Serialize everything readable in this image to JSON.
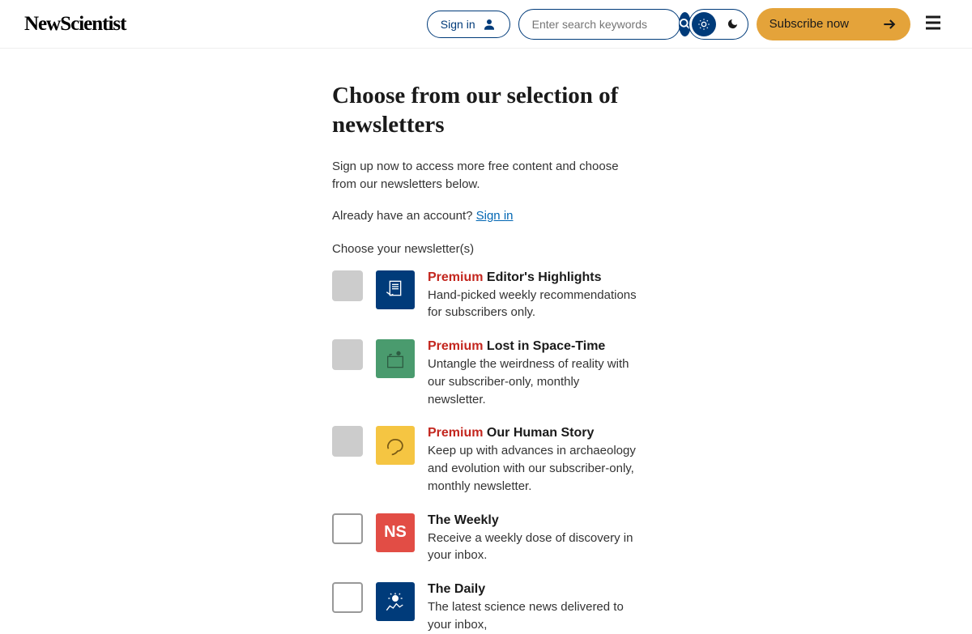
{
  "header": {
    "logo": "NewScientist",
    "signin": "Sign in",
    "search_placeholder": "Enter search keywords",
    "subscribe": "Subscribe now"
  },
  "page": {
    "title": "Choose from our selection of newsletters",
    "intro": "Sign up now to access more free content and choose from our newsletters below.",
    "account_prefix": "Already have an account? ",
    "signin_link": "Sign in",
    "choose_label": "Choose your newsletter(s)"
  },
  "newsletters": [
    {
      "premium": "Premium",
      "title": "Editor's Highlights",
      "desc": "Hand-picked weekly recommendations for subscribers only.",
      "disabled": true,
      "icon_bg": "#003b7a"
    },
    {
      "premium": "Premium",
      "title": "Lost in Space-Time",
      "desc": "Untangle the weirdness of reality with our subscriber-only, monthly newsletter.",
      "disabled": true,
      "icon_bg": "#4a9b6e"
    },
    {
      "premium": "Premium",
      "title": "Our Human Story",
      "desc": "Keep up with advances in archaeology and evolution with our subscriber-only, monthly newsletter.",
      "disabled": true,
      "icon_bg": "#f5c542"
    },
    {
      "premium": "",
      "title": "The Weekly",
      "desc": "Receive a weekly dose of discovery in your inbox.",
      "disabled": false,
      "icon_bg": "#e24d45"
    },
    {
      "premium": "",
      "title": "The Daily",
      "desc": "The latest science news delivered to your inbox,",
      "disabled": false,
      "icon_bg": "#003b7a"
    }
  ]
}
